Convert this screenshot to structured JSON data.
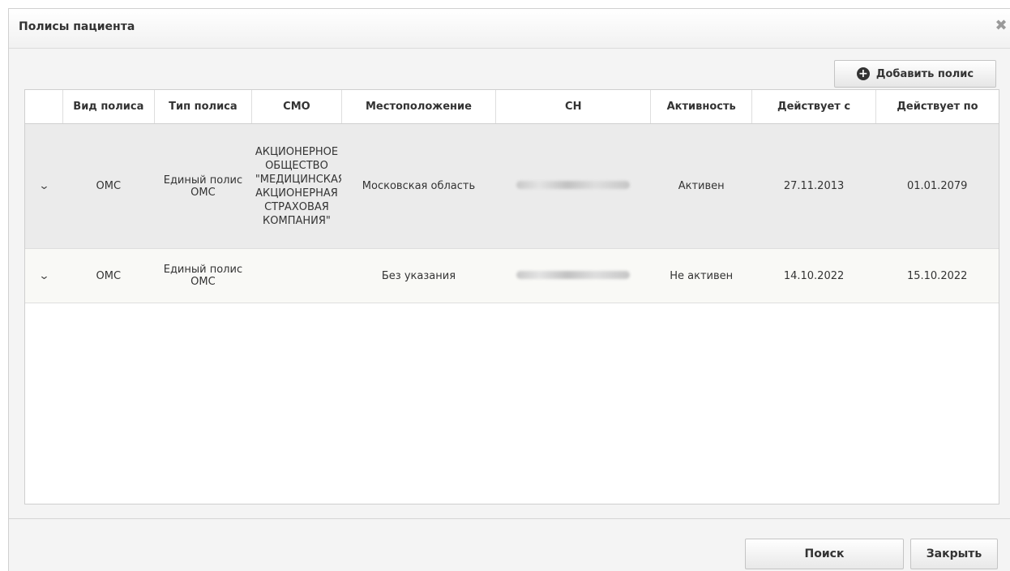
{
  "dialog": {
    "title": "Полисы пациента",
    "close_icon": "close-icon"
  },
  "toolbar": {
    "add_label": "Добавить полис",
    "add_icon": "plus-circle-icon"
  },
  "table": {
    "columns": [
      "",
      "Вид полиса",
      "Тип полиса",
      "СМО",
      "Местоположение",
      "СН",
      "Активность",
      "Действует с",
      "Действует по"
    ],
    "rows": [
      {
        "expand_icon": "chevron-down-icon",
        "kind": "ОМС",
        "type": "Единый полис ОМС",
        "smo": "АКЦИОНЕРНОЕ ОБЩЕСТВО \"МЕДИЦИНСКАЯ АКЦИОНЕРНАЯ СТРАХОВАЯ КОМПАНИЯ\"",
        "location": "Московская область",
        "sn": "",
        "status": "Активен",
        "from": "27.11.2013",
        "to": "01.01.2079"
      },
      {
        "expand_icon": "chevron-down-icon",
        "kind": "ОМС",
        "type": "Единый полис ОМС",
        "smo": "",
        "location": "Без указания",
        "sn": "",
        "status": "Не активен",
        "from": "14.10.2022",
        "to": "15.10.2022"
      }
    ]
  },
  "footer": {
    "search_label": "Поиск",
    "close_label": "Закрыть"
  }
}
